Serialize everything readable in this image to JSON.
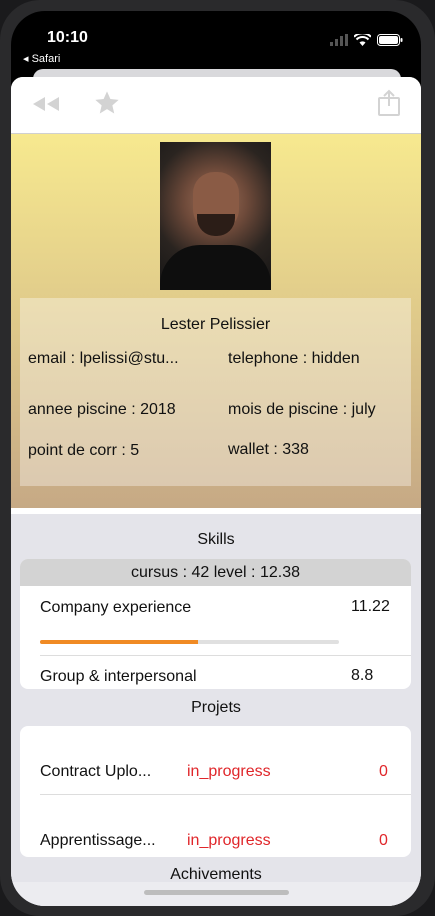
{
  "status_bar": {
    "time": "10:10",
    "back_app": "◂ Safari"
  },
  "profile": {
    "name": "Lester Pelissier",
    "email": "email : lpelissi@stu...",
    "telephone": "telephone : hidden",
    "annee_piscine": "annee piscine : 2018",
    "mois_piscine": "mois de piscine : july",
    "point_corr": "point de corr : 5",
    "wallet": "wallet : 338"
  },
  "skills": {
    "title": "Skills",
    "cursus": "cursus : 42 level : 12.38",
    "items": [
      {
        "name": "Company experience",
        "value": "11.22",
        "progress": 0.53
      },
      {
        "name": "Group & interpersonal",
        "value": "8.8"
      }
    ]
  },
  "projects": {
    "title": "Projets",
    "items": [
      {
        "name": "Contract Uplo...",
        "status": "in_progress",
        "mark": "0"
      },
      {
        "name": "Apprentissage...",
        "status": "in_progress",
        "mark": "0"
      }
    ]
  },
  "achievements": {
    "title": "Achivements"
  },
  "colors": {
    "accent": "#f08a24",
    "status_red": "#e0262a",
    "header_top": "#f7e98f",
    "header_bottom": "#c6a985"
  },
  "icons": {
    "back": "rewind-icon",
    "favorite": "star-icon",
    "share": "share-icon"
  }
}
